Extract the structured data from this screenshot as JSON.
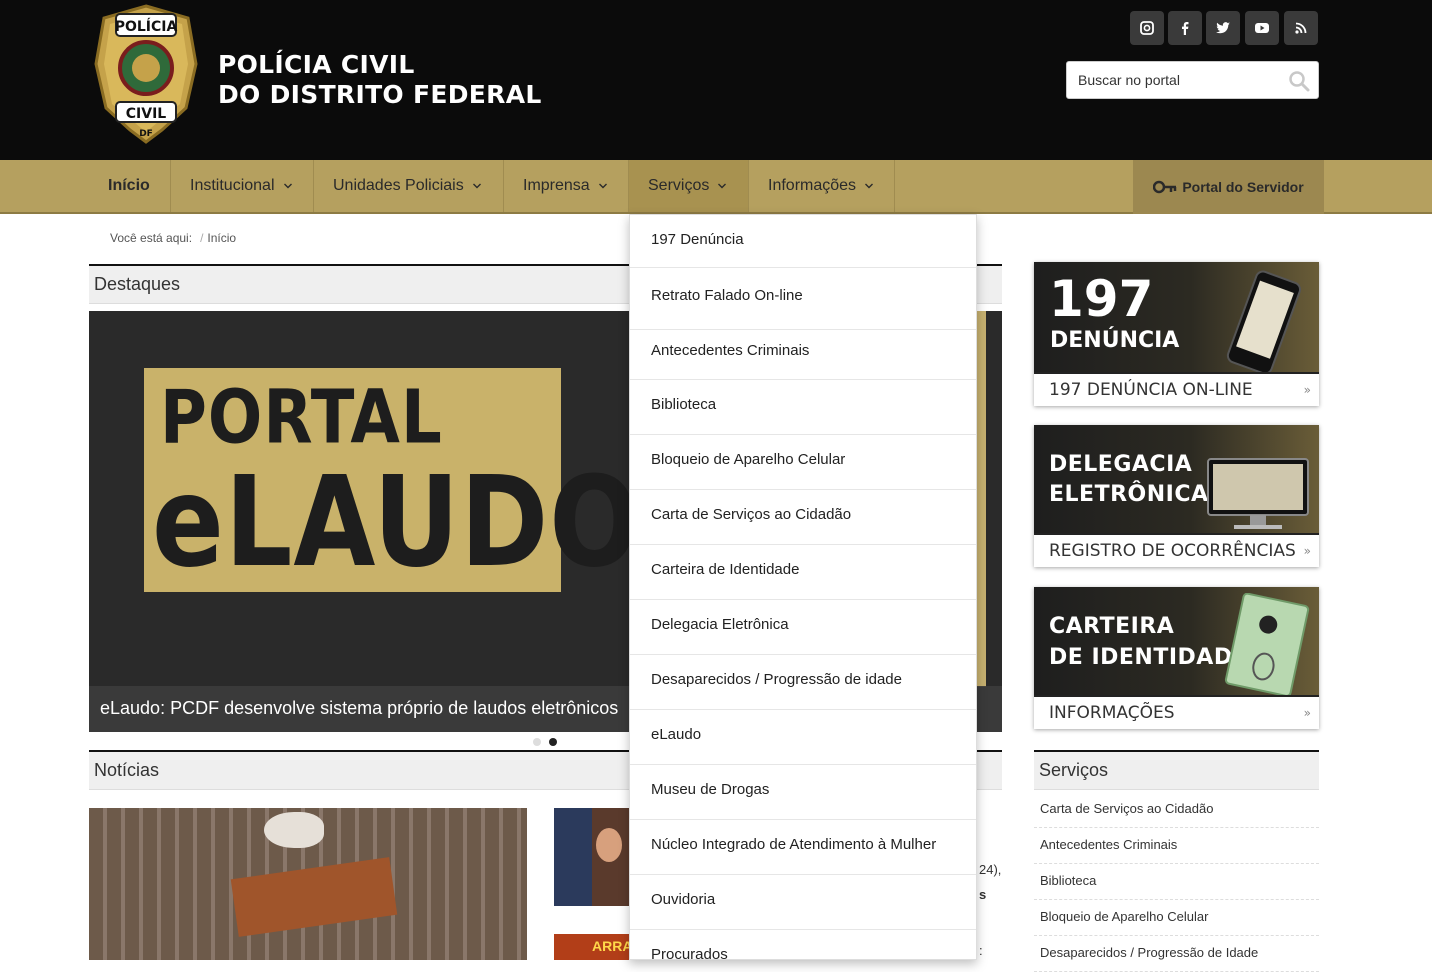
{
  "header": {
    "title_line1": "POLÍCIA CIVIL",
    "title_line2": "DO DISTRITO FEDERAL",
    "badge_top": "POLÍCIA",
    "badge_bottom": "CIVIL",
    "badge_df": "DF",
    "social_icons": [
      "instagram-icon",
      "facebook-icon",
      "twitter-icon",
      "youtube-icon",
      "rss-icon"
    ],
    "search_placeholder": "Buscar no portal"
  },
  "nav": {
    "items": [
      "Início",
      "Institucional",
      "Unidades Policiais",
      "Imprensa",
      "Serviços",
      "Informações"
    ],
    "servidor": "Portal do Servidor"
  },
  "breadcrumb": {
    "label": "Você está aqui:",
    "current": "Início"
  },
  "destaques": {
    "heading": "Destaques",
    "slide_line1": "PORTAL",
    "slide_line2": "eLAUDO",
    "caption": "eLaudo: PCDF desenvolve sistema próprio de laudos eletrônicos"
  },
  "noticias": {
    "heading": "Notícias",
    "frag1": "24),",
    "frag2": "s",
    "frag3": ":",
    "thumb_text": "ARRAIÁ"
  },
  "servicos_dropdown": [
    "197 Denúncia",
    "Retrato Falado On-line",
    "Antecedentes Criminais",
    "Biblioteca",
    "Bloqueio de Aparelho Celular",
    "Carta de Serviços ao Cidadão",
    "Carteira de Identidade",
    "Delegacia Eletrônica",
    "Desaparecidos / Progressão de idade",
    "eLaudo",
    "Museu de Drogas",
    "Núcleo Integrado de Atendimento à Mulher",
    "Ouvidoria",
    "Procurados"
  ],
  "banners": [
    {
      "big1": "197",
      "big2": "DENÚNCIA",
      "foot": "197 DENÚNCIA ON-LINE"
    },
    {
      "big1": "DELEGACIA",
      "big2": "ELETRÔNICA",
      "foot": "REGISTRO DE OCORRÊNCIAS"
    },
    {
      "big1": "CARTEIRA",
      "big2": "DE IDENTIDADE",
      "foot": "INFORMAÇÕES"
    }
  ],
  "sidebar_servicos": {
    "heading": "Serviços",
    "items": [
      "Carta de Serviços ao Cidadão",
      "Antecedentes Criminais",
      "Biblioteca",
      "Bloqueio de Aparelho Celular",
      "Desaparecidos / Progressão de Idade"
    ]
  },
  "colors": {
    "gold": "#b5a05f",
    "header_bg": "#0b0b0b"
  }
}
